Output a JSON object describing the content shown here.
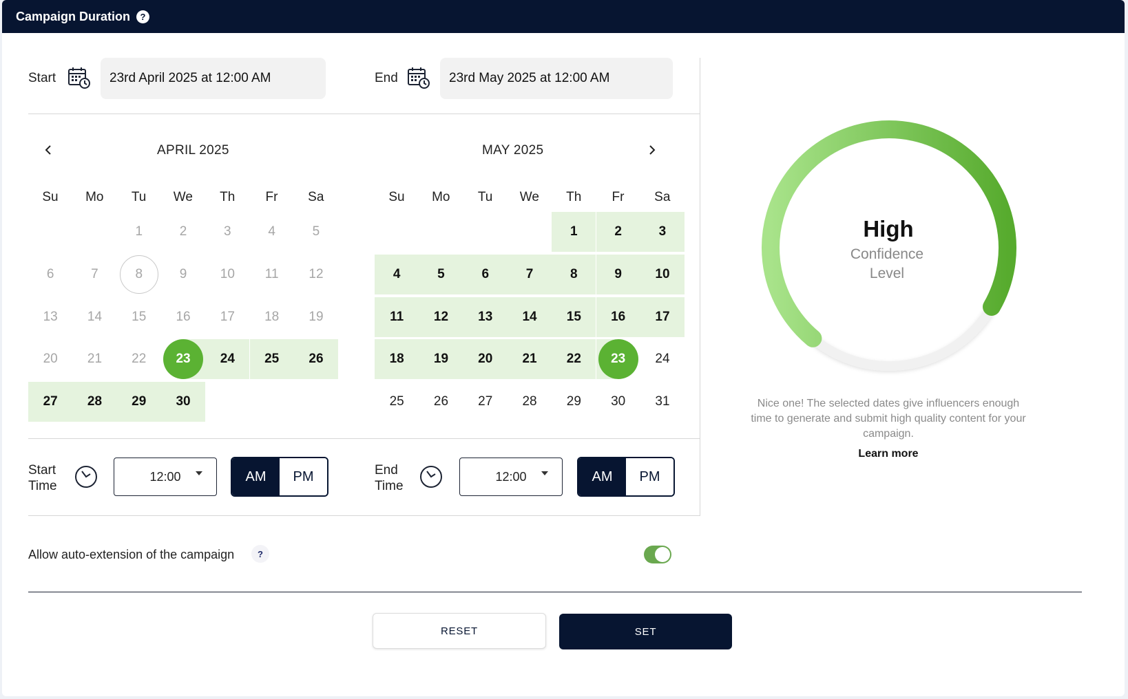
{
  "header": {
    "title": "Campaign Duration",
    "help_icon": "?"
  },
  "range": {
    "start_label": "Start",
    "start_value": "23rd April 2025 at 12:00 AM",
    "end_label": "End",
    "end_value": "23rd May 2025 at 12:00 AM"
  },
  "weekday_labels": [
    "Su",
    "Mo",
    "Tu",
    "We",
    "Th",
    "Fr",
    "Sa"
  ],
  "calendars": [
    {
      "title": "APRIL 2025",
      "first_weekday": 2,
      "days_in_month": 30,
      "today": 8,
      "selected": 23,
      "range_from": 23,
      "range_to": 30
    },
    {
      "title": "MAY 2025",
      "first_weekday": 4,
      "days_in_month": 31,
      "today": null,
      "selected": 23,
      "range_from": 1,
      "range_to": 23
    }
  ],
  "time": {
    "start_label_line1": "Start",
    "start_label_line2": "Time",
    "start_value": "12:00",
    "end_label_line1": "End",
    "end_label_line2": "Time",
    "end_value": "12:00",
    "am": "AM",
    "pm": "PM",
    "start_meridiem": "AM",
    "end_meridiem": "AM"
  },
  "auto_extension": {
    "label": "Allow auto-extension of the campaign",
    "help": "?",
    "enabled": true
  },
  "buttons": {
    "reset": "RESET",
    "set": "SET"
  },
  "confidence": {
    "level": "High",
    "label_line1": "Confidence",
    "label_line2": "Level",
    "message": "Nice one! The selected dates give influencers enough time to generate and submit high quality content for your campaign.",
    "learn_more": "Learn more",
    "gauge_fraction": 1.0
  },
  "colors": {
    "header_bg": "#071531",
    "accent_green": "#5bb233",
    "range_bg": "#e5f3de",
    "toggle_on": "#6aa84f"
  },
  "icons": {
    "calendar": "calendar-clock-icon",
    "clock": "clock-icon",
    "prev": "chevron-left-icon",
    "next": "chevron-right-icon"
  }
}
